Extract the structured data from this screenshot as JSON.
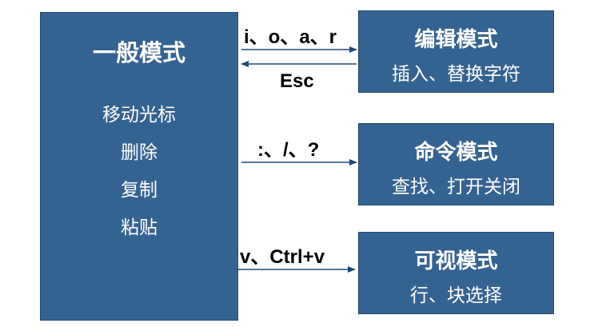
{
  "normal_mode": {
    "title": "一般模式",
    "items": [
      "移动光标",
      "删除",
      "复制",
      "粘贴"
    ]
  },
  "edit_mode": {
    "title": "编辑模式",
    "description": "插入、替换字符",
    "enter_keys": "i、o、a、r",
    "exit_key": "Esc"
  },
  "command_mode": {
    "title": "命令模式",
    "description": "查找、打开关闭",
    "enter_keys": ":、/、?"
  },
  "visual_mode": {
    "title": "可视模式",
    "description": "行、块选择",
    "enter_keys": "v、Ctrl+v"
  },
  "colors": {
    "box_fill": "#356391",
    "box_border": "#22486d",
    "arrow": "#1f4a78",
    "text_on_box": "#ffffff",
    "label_text": "#000000"
  }
}
